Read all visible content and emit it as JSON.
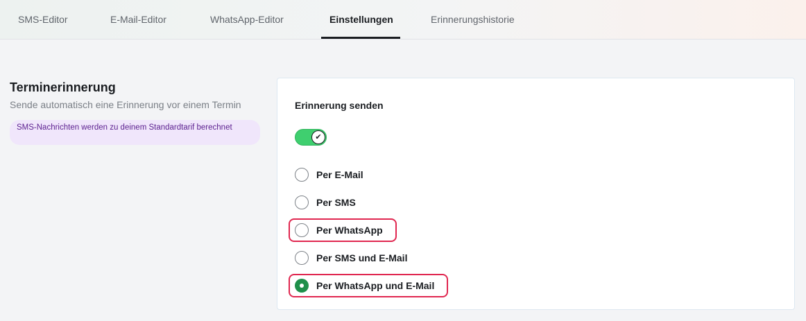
{
  "tabs": [
    {
      "label": "SMS-Editor",
      "active": false
    },
    {
      "label": "E-Mail-Editor",
      "active": false
    },
    {
      "label": "WhatsApp-Editor",
      "active": false
    },
    {
      "label": "Einstellungen",
      "active": true
    },
    {
      "label": "Erinnerungshistorie",
      "active": false
    }
  ],
  "section": {
    "title": "Terminerinnerung",
    "description": "Sende automatisch eine Erinnerung vor einem Termin",
    "note": "SMS-Nachrichten werden zu deinem Standardtarif berechnet"
  },
  "card": {
    "label": "Erinnerung senden",
    "toggle_on": true,
    "toggle_icon": "check-icon",
    "options": [
      {
        "label": "Per E-Mail",
        "selected": false
      },
      {
        "label": "Per SMS",
        "selected": false
      },
      {
        "label": "Per WhatsApp",
        "selected": false
      },
      {
        "label": "Per SMS und E-Mail",
        "selected": false
      },
      {
        "label": "Per WhatsApp und E-Mail",
        "selected": true
      }
    ]
  },
  "colors": {
    "accent_green": "#3fcf6f",
    "radio_selected": "#1f8f4a",
    "highlight_red": "#e0264f",
    "note_bg": "#f0e6fb",
    "note_text": "#5b1f8f"
  }
}
